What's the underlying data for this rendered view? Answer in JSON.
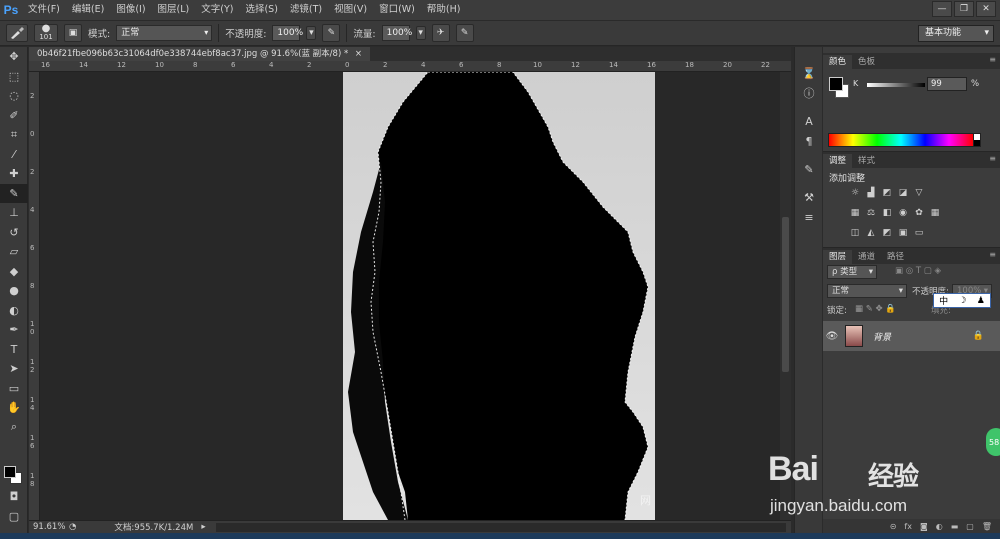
{
  "app": {
    "logo": "Ps",
    "menu": [
      "文件(F)",
      "编辑(E)",
      "图像(I)",
      "图层(L)",
      "文字(Y)",
      "选择(S)",
      "滤镜(T)",
      "视图(V)",
      "窗口(W)",
      "帮助(H)"
    ],
    "window_controls": [
      "—",
      "❐",
      "✕"
    ]
  },
  "options": {
    "brush_size": "101",
    "mode_label": "模式:",
    "mode_value": "正常",
    "opacity_label": "不透明度:",
    "opacity_value": "100%",
    "flow_label": "流量:",
    "flow_value": "100%",
    "workspace": "基本功能"
  },
  "document": {
    "tab_title": "0b46f21fbe096b63c31064df0e338744ebf8ac37.jpg @ 91.6%(蓝 副本/8) *",
    "ruler_h": [
      "16",
      "14",
      "12",
      "10",
      "8",
      "6",
      "4",
      "2",
      "0",
      "2",
      "4",
      "6",
      "8",
      "10",
      "12",
      "14",
      "16",
      "18",
      "20",
      "22",
      "24"
    ],
    "ruler_v": [
      "2",
      "0",
      "2",
      "4",
      "6",
      "8",
      "1 0",
      "1 2",
      "1 4",
      "1 6",
      "1 8",
      "2 0",
      "2 2"
    ],
    "zoom": "91.61%",
    "doc_size": "文档:955.7K/1.24M"
  },
  "panels": {
    "color_tabs": [
      "颜色",
      "色板"
    ],
    "k_label": "K",
    "k_value": "99",
    "k_unit": "%",
    "adjust_tabs": [
      "调整",
      "样式"
    ],
    "adjust_title": "添加调整",
    "layers_tabs": [
      "图层",
      "通道",
      "路径"
    ],
    "kind_filter": "ρ 类型",
    "blend_mode": "正常",
    "opacity_label": "不透明度:",
    "opacity_value": "100%",
    "lock_label": "锁定:",
    "fill_label": "填充:",
    "layer_name": "背景"
  },
  "ime": {
    "label": "中"
  },
  "watermark": {
    "main": "Bai",
    "main2": "经验",
    "sub": "jingyan.baidu.com",
    "small": "网",
    "badge": "58"
  }
}
